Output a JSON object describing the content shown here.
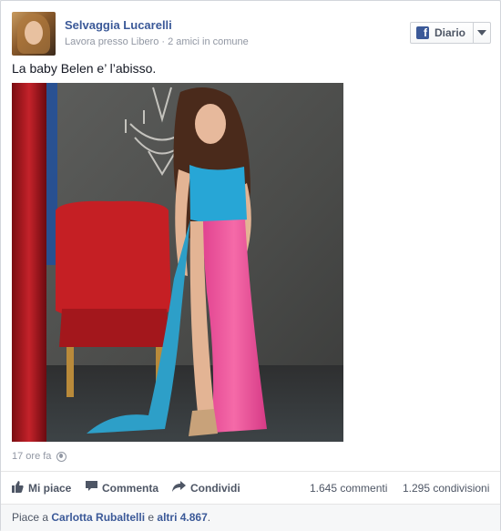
{
  "post": {
    "author": "Selvaggia Lucarelli",
    "subtitle": "Lavora presso Libero · 2 amici in comune",
    "follow_button": {
      "label": "Diario",
      "icon": "facebook-icon"
    },
    "text": "La baby Belen e’ l’abisso.",
    "timestamp": "17 ore fa",
    "privacy_icon": "globe-icon"
  },
  "actions": {
    "like": "Mi piace",
    "comment": "Commenta",
    "share": "Condividi"
  },
  "stats": {
    "comments": "1.645 commenti",
    "shares": "1.295 condivisioni"
  },
  "likes_line": {
    "prefix": "Piace a ",
    "person": "Carlotta Rubaltelli",
    "middle": " e ",
    "others": "altri 4.867",
    "suffix": "."
  },
  "colors": {
    "link": "#3b5998",
    "muted": "#9197a3",
    "action": "#4e5665"
  }
}
